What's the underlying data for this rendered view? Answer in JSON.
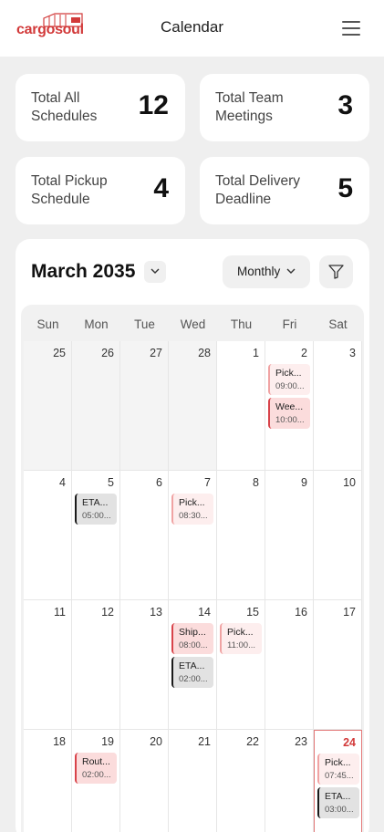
{
  "header": {
    "logo_text": "cargosoul",
    "title": "Calendar",
    "menu_icon": "hamburger-menu-icon",
    "brand_color": "#d23a3a"
  },
  "stats": [
    {
      "label": "Total All Schedules",
      "value": "12"
    },
    {
      "label": "Total Team Meetings",
      "value": "3"
    },
    {
      "label": "Total Pickup Schedule",
      "value": "4"
    },
    {
      "label": "Total Delivery Deadline",
      "value": "5"
    }
  ],
  "calendar": {
    "month_label": "March 2035",
    "view_label": "Monthly",
    "filter_icon": "filter-icon",
    "weekdays": [
      "Sun",
      "Mon",
      "Tue",
      "Wed",
      "Thu",
      "Fri",
      "Sat"
    ],
    "today_color": "#d23a3a",
    "weeks": [
      [
        {
          "day": "25",
          "outside": true,
          "events": []
        },
        {
          "day": "26",
          "outside": true,
          "events": []
        },
        {
          "day": "27",
          "outside": true,
          "events": []
        },
        {
          "day": "28",
          "outside": true,
          "events": []
        },
        {
          "day": "1",
          "events": []
        },
        {
          "day": "2",
          "events": [
            {
              "title": "Pick...",
              "time": "09:00...",
              "style": "light"
            },
            {
              "title": "Wee...",
              "time": "10:00...",
              "style": "red"
            }
          ]
        },
        {
          "day": "3",
          "events": []
        }
      ],
      [
        {
          "day": "4",
          "events": []
        },
        {
          "day": "5",
          "events": [
            {
              "title": "ETA...",
              "time": "05:00...",
              "style": "dark"
            }
          ]
        },
        {
          "day": "6",
          "events": []
        },
        {
          "day": "7",
          "events": [
            {
              "title": "Pick...",
              "time": "08:30...",
              "style": "light"
            }
          ]
        },
        {
          "day": "8",
          "events": []
        },
        {
          "day": "9",
          "events": []
        },
        {
          "day": "10",
          "events": []
        }
      ],
      [
        {
          "day": "11",
          "events": []
        },
        {
          "day": "12",
          "events": []
        },
        {
          "day": "13",
          "events": []
        },
        {
          "day": "14",
          "events": [
            {
              "title": "Ship...",
              "time": "08:00...",
              "style": "red"
            },
            {
              "title": "ETA...",
              "time": "02:00...",
              "style": "dark"
            }
          ]
        },
        {
          "day": "15",
          "events": [
            {
              "title": "Pick...",
              "time": "11:00...",
              "style": "light"
            }
          ]
        },
        {
          "day": "16",
          "events": []
        },
        {
          "day": "17",
          "events": []
        }
      ],
      [
        {
          "day": "18",
          "events": []
        },
        {
          "day": "19",
          "events": [
            {
              "title": "Rout...",
              "time": "02:00...",
              "style": "red"
            }
          ]
        },
        {
          "day": "20",
          "events": []
        },
        {
          "day": "21",
          "events": []
        },
        {
          "day": "22",
          "events": []
        },
        {
          "day": "23",
          "events": []
        },
        {
          "day": "24",
          "today": true,
          "events": [
            {
              "title": "Pick...",
              "time": "07:45...",
              "style": "light"
            },
            {
              "title": "ETA...",
              "time": "03:00...",
              "style": "dark"
            }
          ]
        }
      ]
    ]
  }
}
